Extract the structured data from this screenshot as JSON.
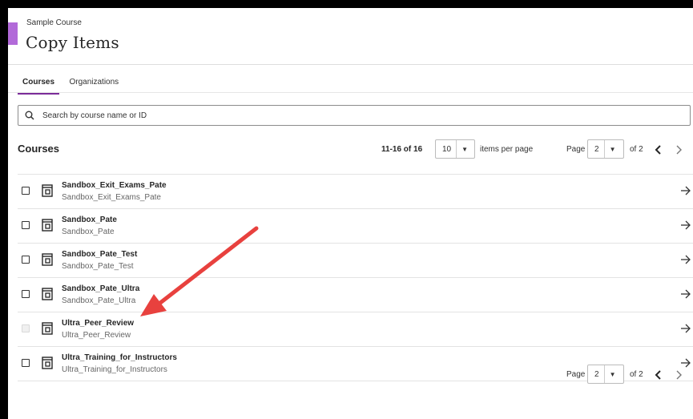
{
  "header": {
    "course_name": "Sample Course",
    "title": "Copy Items",
    "accent_color": "#b26ad9"
  },
  "tabs": [
    {
      "label": "Courses",
      "active": true
    },
    {
      "label": "Organizations",
      "active": false
    }
  ],
  "tab_accent": "#7b2c99",
  "search": {
    "placeholder": "Search by course name or ID",
    "value": "",
    "icon": "search-icon"
  },
  "list": {
    "heading": "Courses",
    "range": "11-16 of 16",
    "items_per_page": "10",
    "items_per_page_label": "items per page",
    "page_label": "Page",
    "current_page": "2",
    "of_label": "of 2"
  },
  "courses": [
    {
      "title": "Sandbox_Exit_Exams_Pate",
      "id": "Sandbox_Exit_Exams_Pate",
      "checkbox_enabled": true
    },
    {
      "title": "Sandbox_Pate",
      "id": "Sandbox_Pate",
      "checkbox_enabled": true
    },
    {
      "title": "Sandbox_Pate_Test",
      "id": "Sandbox_Pate_Test",
      "checkbox_enabled": true
    },
    {
      "title": "Sandbox_Pate_Ultra",
      "id": "Sandbox_Pate_Ultra",
      "checkbox_enabled": true
    },
    {
      "title": "Ultra_Peer_Review",
      "id": "Ultra_Peer_Review",
      "checkbox_enabled": false
    },
    {
      "title": "Ultra_Training_for_Instructors",
      "id": "Ultra_Training_for_Instructors",
      "checkbox_enabled": true
    }
  ],
  "footer": {
    "page_label": "Page",
    "current_page": "2",
    "of_label": "of 2"
  },
  "annotation": {
    "color": "#e8413e",
    "icon": "annotation-arrow-icon"
  }
}
